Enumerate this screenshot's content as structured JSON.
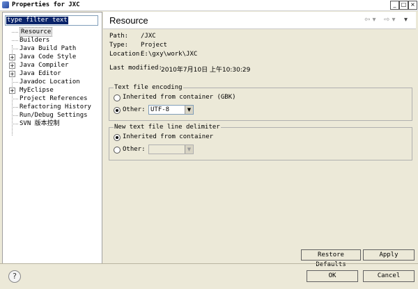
{
  "window": {
    "title": "Properties for JXC",
    "controls": [
      "_",
      "□",
      "×"
    ]
  },
  "sidebar": {
    "filter_placeholder": "type filter text",
    "items": [
      {
        "label": "Resource",
        "expandable": false,
        "selected": true
      },
      {
        "label": "Builders",
        "expandable": false
      },
      {
        "label": "Java Build Path",
        "expandable": false
      },
      {
        "label": "Java Code Style",
        "expandable": true
      },
      {
        "label": "Java Compiler",
        "expandable": true
      },
      {
        "label": "Java Editor",
        "expandable": true
      },
      {
        "label": "Javadoc Location",
        "expandable": false
      },
      {
        "label": "MyEclipse",
        "expandable": true
      },
      {
        "label": "Project References",
        "expandable": false
      },
      {
        "label": "Refactoring History",
        "expandable": false
      },
      {
        "label": "Run/Debug Settings",
        "expandable": false
      },
      {
        "label": "SVN 版本控制",
        "expandable": false
      }
    ]
  },
  "page": {
    "title": "Resource",
    "nav_icons": [
      "back-arrow-icon",
      "forward-arrow-icon",
      "menu-dropdown-icon"
    ],
    "props": {
      "path_label": "Path:",
      "path_value": "/JXC",
      "type_label": "Type:",
      "type_value": "Project",
      "location_label": "Location:",
      "location_value": "E:\\gxy\\work\\JXC",
      "modified_label": "Last modified:",
      "modified_value": "2010年7月10日 上午10:30:29"
    },
    "encoding": {
      "legend": "Text file encoding",
      "inherited_label": "Inherited from container (GBK)",
      "other_label": "Other:",
      "other_value": "UTF-8",
      "selected": "other"
    },
    "delimiter": {
      "legend": "New text file line delimiter",
      "inherited_label": "Inherited from container",
      "other_label": "Other:",
      "other_value": "",
      "selected": "inherited"
    },
    "restore_label": "Restore Defaults",
    "apply_label": "Apply"
  },
  "footer": {
    "help_glyph": "?",
    "ok_label": "OK",
    "cancel_label": "Cancel"
  }
}
